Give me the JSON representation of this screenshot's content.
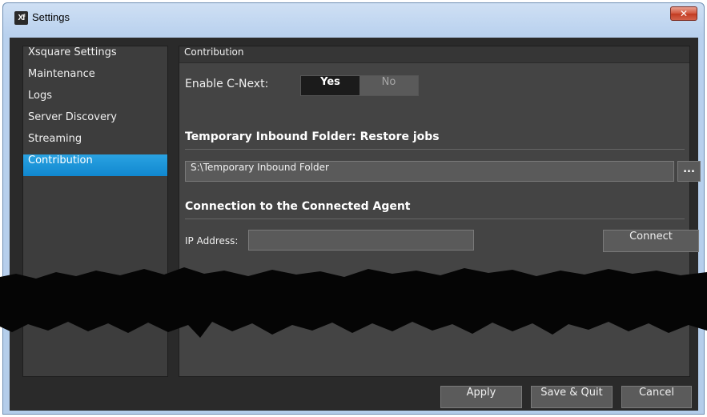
{
  "window": {
    "title": "Settings",
    "app_icon": "xsquare-app-icon",
    "close_glyph": "✕"
  },
  "sidebar": {
    "items": [
      {
        "label": "Xsquare Settings",
        "active": false
      },
      {
        "label": "Maintenance",
        "active": false
      },
      {
        "label": "Logs",
        "active": false
      },
      {
        "label": "Server Discovery",
        "active": false
      },
      {
        "label": "Streaming",
        "active": false
      },
      {
        "label": "Contribution",
        "active": true
      }
    ]
  },
  "panel": {
    "header": "Contribution",
    "enable_cnext": {
      "label": "Enable C-Next:",
      "yes": "Yes",
      "no": "No",
      "selected": "Yes"
    },
    "inbound": {
      "title": "Temporary Inbound Folder: Restore jobs",
      "path": "S:\\Temporary Inbound Folder",
      "browse_label": "..."
    },
    "agent": {
      "title": "Connection to the Connected Agent",
      "ip_label": "IP Address:",
      "ip_value": "",
      "connect_label": "Connect"
    }
  },
  "footer": {
    "apply": "Apply",
    "save_quit": "Save & Quit",
    "cancel": "Cancel"
  },
  "colors": {
    "accent": "#1a8fd6",
    "background": "#2a2a2a",
    "panel": "#444444"
  }
}
